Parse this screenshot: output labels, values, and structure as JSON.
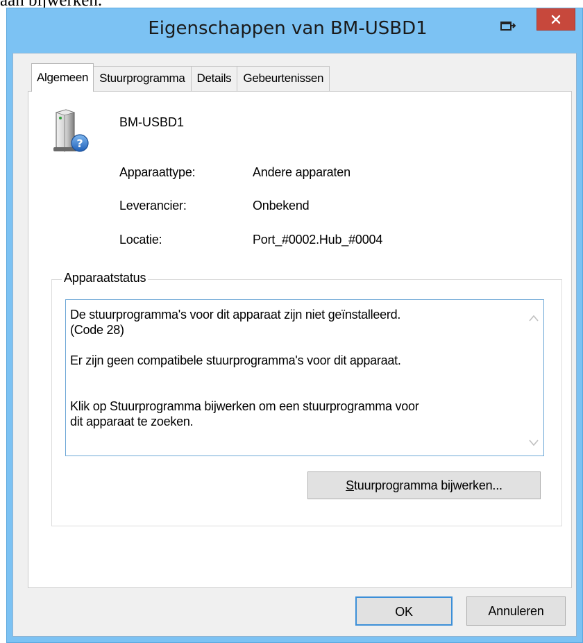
{
  "background_text": "aan bijwerken.",
  "window": {
    "title": "Eigenschappen van BM-USBD1",
    "accent_color": "#7cc2f3",
    "close_color": "#c7483c"
  },
  "tabs": [
    {
      "label": "Algemeen",
      "active": true
    },
    {
      "label": "Stuurprogramma",
      "active": false
    },
    {
      "label": "Details",
      "active": false
    },
    {
      "label": "Gebeurtenissen",
      "active": false
    }
  ],
  "device": {
    "icon": "unknown-device-icon",
    "name": "BM-USBD1",
    "properties": [
      {
        "label": "Apparaattype:",
        "value": "Andere apparaten"
      },
      {
        "label": "Leverancier:",
        "value": "Onbekend"
      },
      {
        "label": "Locatie:",
        "value": "Port_#0002.Hub_#0004"
      }
    ]
  },
  "status": {
    "legend": "Apparaatstatus",
    "text": "De stuurprogramma's voor dit apparaat zijn niet geïnstalleerd.\n(Code 28)\n\nEr zijn geen compatibele stuurprogramma's voor dit apparaat.\n\n\nKlik op Stuurprogramma bijwerken om een stuurprogramma voor\ndit apparaat te zoeken.",
    "update_button": {
      "accel": "S",
      "rest": "tuurprogramma bijwerken..."
    }
  },
  "buttons": {
    "ok": "OK",
    "cancel": "Annuleren"
  }
}
